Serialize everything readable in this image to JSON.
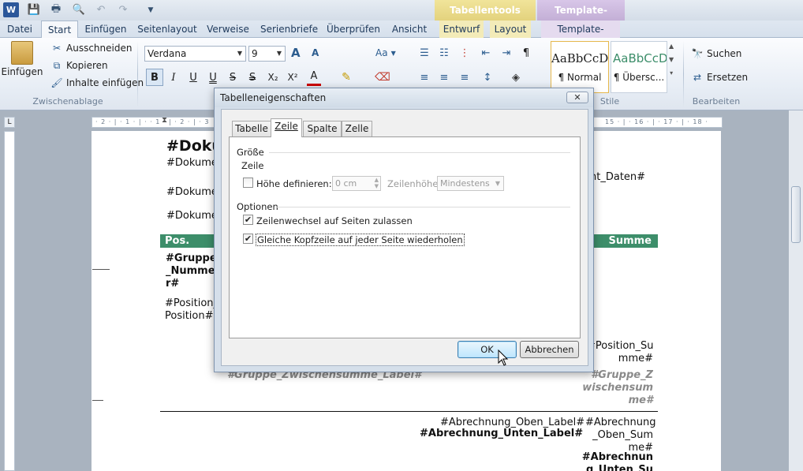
{
  "quick_access": {
    "icons": [
      "word-logo-icon",
      "save-icon",
      "print-icon",
      "print-preview-icon",
      "undo-icon",
      "redo-icon",
      "customize-icon"
    ]
  },
  "context_bands": {
    "tabellentools": "Tabellentools",
    "template_design": "Template-Design"
  },
  "tabs": [
    {
      "label": "Datei"
    },
    {
      "label": "Start"
    },
    {
      "label": "Einfügen"
    },
    {
      "label": "Seitenlayout"
    },
    {
      "label": "Verweise"
    },
    {
      "label": "Serienbriefe"
    },
    {
      "label": "Überprüfen"
    },
    {
      "label": "Ansicht"
    },
    {
      "label": "Entwurf"
    },
    {
      "label": "Layout"
    },
    {
      "label": "Template-Design"
    }
  ],
  "ribbon": {
    "clipboard": {
      "paste": "Einfügen",
      "cut": "Ausschneiden",
      "copy": "Kopieren",
      "paste_special": "Inhalte einfügen",
      "group_label": "Zwischenablage"
    },
    "font": {
      "family": "Verdana",
      "size": "9",
      "grow": "A",
      "shrink": "A",
      "case": "Aa",
      "bold": "B",
      "italic": "I",
      "underline": "U",
      "strike": "S",
      "subscript": "X₂",
      "superscript": "X²",
      "color": "A"
    },
    "styles": {
      "style1_preview": "AaBbCcD",
      "style1_name": "¶ Normal",
      "style2_preview": "AaBbCcD",
      "style2_name": "¶ Übersc...",
      "group_label": "Stile"
    },
    "edit": {
      "find": "Suchen",
      "replace": "Ersetzen",
      "group_label": "Bearbeiten"
    }
  },
  "ruler": {
    "ticks": "· 2 · | · 1 · | ·   · 1 · | · 2 · | · 3",
    "ticks_right": "15 · | · 16 · | · 17 · | · 18 ·"
  },
  "document": {
    "heading": "#Doku",
    "line1": "#Dokume",
    "line1_right": "nt_Daten#",
    "line2": "#Dokume",
    "line3": "#Dokume",
    "header_pos": "Pos.",
    "header_sum": "Summe",
    "group_num": "#Gruppe\n_Numme\nr#",
    "position": "#Position_\nPosition#",
    "position_sum": "#Position_Su\nmme#",
    "zwischen_label": "#Gruppe_Zwischensumme_Label#",
    "zwischen_sum": "#Gruppe_Z\nwischensum\nme#",
    "abr_oben_label": "#Abrechnung_Oben_Label#",
    "abr_oben_sum": "#Abrechnung\n_Oben_Sum\nme#",
    "abr_unten_label": "#Abrechnung_Unten_Label#",
    "abr_unten_sum": "#Abrechnun\ng_Unten_Su"
  },
  "dialog": {
    "title": "Tabelleneigenschaften",
    "close": "✕",
    "tabs": [
      "Tabelle",
      "Zeile",
      "Spalte",
      "Zelle"
    ],
    "section_size": "Größe",
    "row_heading": "Zeile",
    "height_label": "Höhe definieren:",
    "height_value": "0 cm",
    "row_height_label": "Zeilenhöhe:",
    "row_height_value": "Mindestens",
    "section_options": "Optionen",
    "option1": "Zeilenwechsel auf Seiten zulassen",
    "option2": "Gleiche Kopfzeile auf jeder Seite wiederholen",
    "option1_checked": true,
    "option2_checked": true,
    "height_checked": false,
    "ok": "OK",
    "cancel": "Abbrechen"
  },
  "colors": {
    "accent_green": "#3d8e6a",
    "context_yellow": "#e8d98a",
    "context_purple": "#c9b7d9"
  }
}
